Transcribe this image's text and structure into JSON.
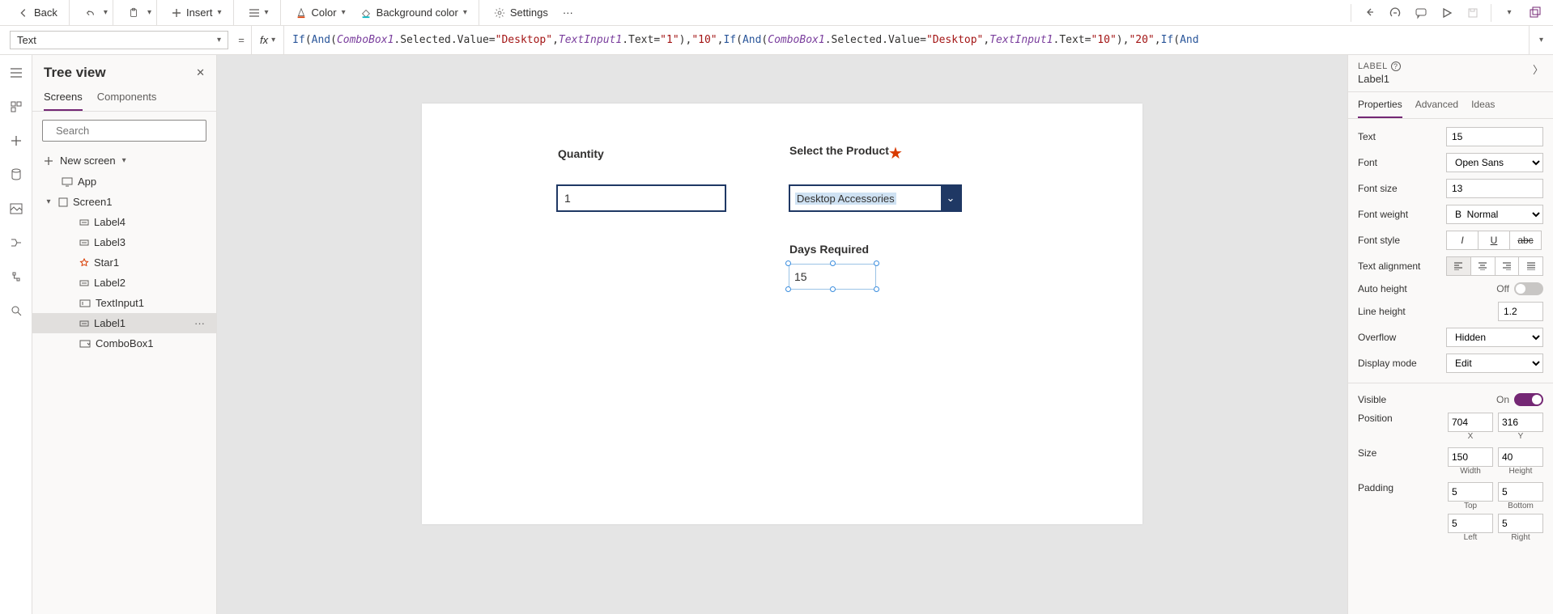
{
  "toolbar": {
    "back": "Back",
    "insert": "Insert",
    "color": "Color",
    "bgcolor": "Background color",
    "settings": "Settings"
  },
  "formula": {
    "property": "Text",
    "fx": "fx",
    "code_html": "<span class='fn'>If</span>(<span class='fn'>And</span>(<span class='id'>ComboBox1</span>.Selected.Value=<span class='lit'>\"Desktop\"</span>,<span class='id'>TextInput1</span>.Text=<span class='lit'>\"1\"</span>),<span class='lit'>\"10\"</span>,<span class='fn'>If</span>(<span class='fn'>And</span>(<span class='id'>ComboBox1</span>.Selected.Value=<span class='lit'>\"Desktop\"</span>,<span class='id'>TextInput1</span>.Text=<span class='lit'>\"10\"</span>),<span class='lit'>\"20\"</span>,<span class='fn'>If</span>(<span class='fn'>And</span>"
  },
  "tree": {
    "title": "Tree view",
    "tab_screens": "Screens",
    "tab_components": "Components",
    "search_placeholder": "Search",
    "new_screen": "New screen",
    "app": "App",
    "nodes": {
      "screen1": "Screen1",
      "label4": "Label4",
      "label3": "Label3",
      "star1": "Star1",
      "label2": "Label2",
      "textinput1": "TextInput1",
      "label1": "Label1",
      "combobox1": "ComboBox1"
    }
  },
  "canvas": {
    "quantity_label": "Quantity",
    "quantity_value": "1",
    "product_label": "Select the Product",
    "product_value": "Desktop Accessories",
    "days_label": "Days Required",
    "days_value": "15"
  },
  "props": {
    "kind": "LABEL",
    "name": "Label1",
    "tab_properties": "Properties",
    "tab_advanced": "Advanced",
    "tab_ideas": "Ideas",
    "rows": {
      "text_label": "Text",
      "text_value": "15",
      "font_label": "Font",
      "font_value": "Open Sans",
      "fontsize_label": "Font size",
      "fontsize_value": "13",
      "fontweight_label": "Font weight",
      "fontweight_value": "Normal",
      "fontstyle_label": "Font style",
      "textalign_label": "Text alignment",
      "autoheight_label": "Auto height",
      "autoheight_value": "Off",
      "lineheight_label": "Line height",
      "lineheight_value": "1.2",
      "overflow_label": "Overflow",
      "overflow_value": "Hidden",
      "displaymode_label": "Display mode",
      "displaymode_value": "Edit",
      "visible_label": "Visible",
      "visible_value": "On",
      "position_label": "Position",
      "position_x": "704",
      "position_y": "316",
      "position_x_sub": "X",
      "position_y_sub": "Y",
      "size_label": "Size",
      "size_w": "150",
      "size_h": "40",
      "size_w_sub": "Width",
      "size_h_sub": "Height",
      "padding_label": "Padding",
      "padding_t": "5",
      "padding_b": "5",
      "padding_l": "5",
      "padding_r": "5",
      "padding_t_sub": "Top",
      "padding_b_sub": "Bottom",
      "padding_l_sub": "Left",
      "padding_r_sub": "Right"
    }
  }
}
